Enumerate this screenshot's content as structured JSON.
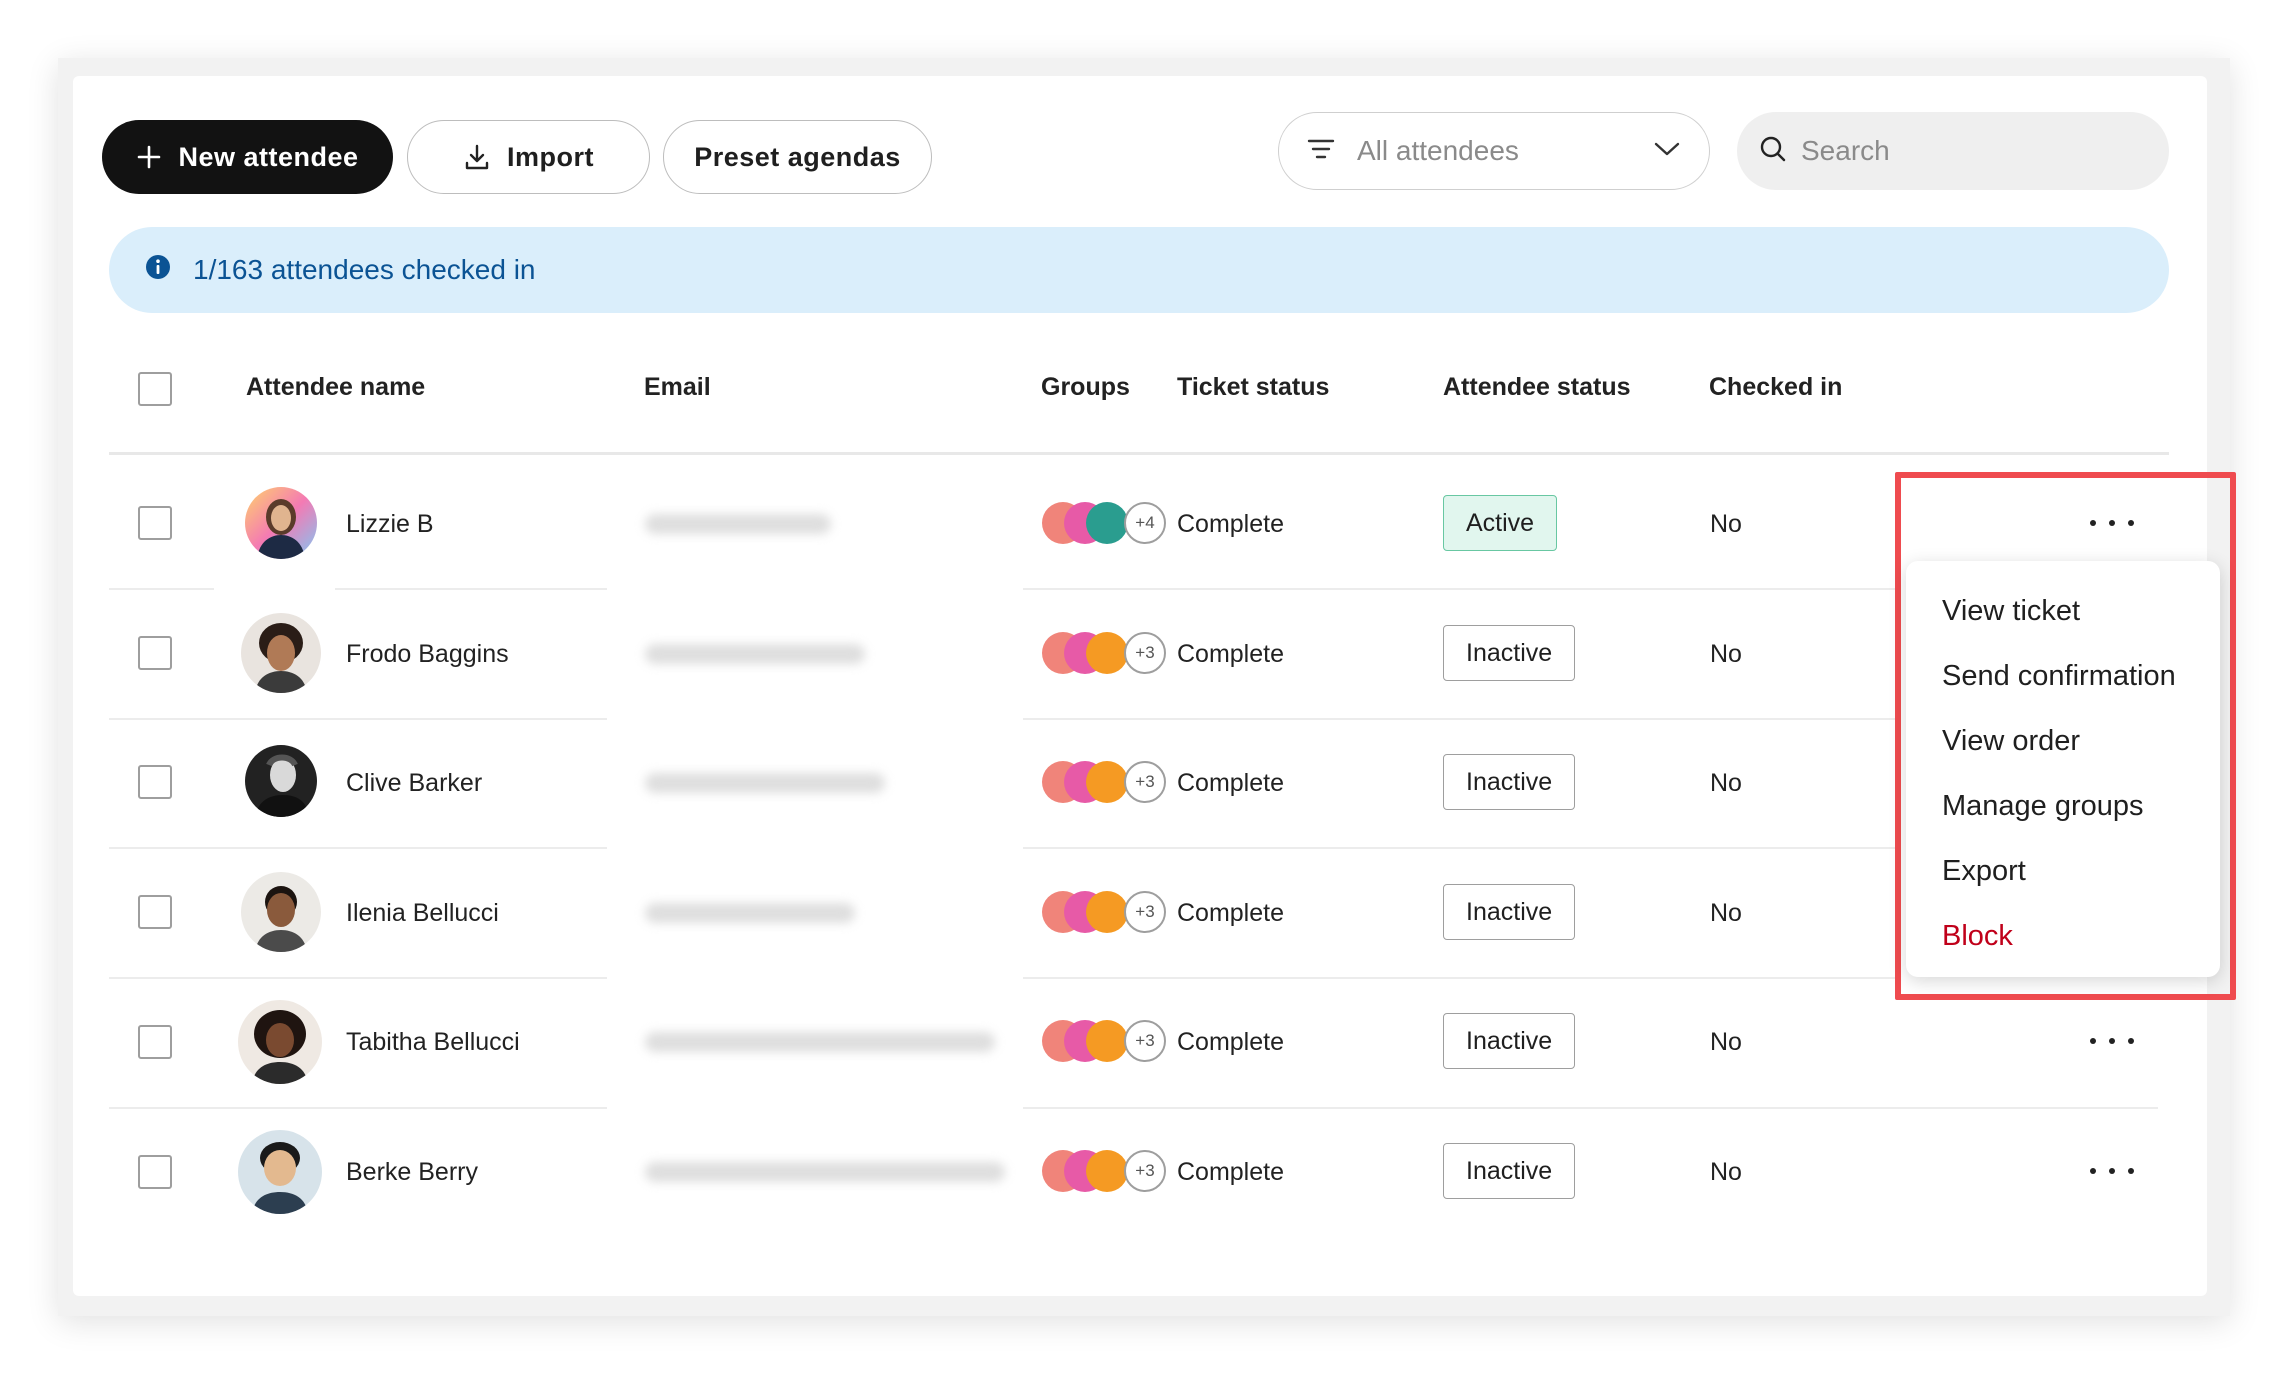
{
  "toolbar": {
    "new_attendee_label": "New attendee",
    "import_label": "Import",
    "preset_label": "Preset agendas",
    "filter_label": "All attendees",
    "search_placeholder": "Search"
  },
  "banner": {
    "text": "1/163 attendees checked in"
  },
  "table": {
    "headers": {
      "name": "Attendee name",
      "email": "Email",
      "groups": "Groups",
      "ticket": "Ticket status",
      "attendee_status": "Attendee status",
      "checked_in": "Checked in"
    },
    "rows": [
      {
        "name": "Lizzie B",
        "groups_more": "+4",
        "ticket_status": "Complete",
        "attendee_status": "Active",
        "checked_in": "No"
      },
      {
        "name": "Frodo Baggins",
        "groups_more": "+3",
        "ticket_status": "Complete",
        "attendee_status": "Inactive",
        "checked_in": "No"
      },
      {
        "name": "Clive Barker",
        "groups_more": "+3",
        "ticket_status": "Complete",
        "attendee_status": "Inactive",
        "checked_in": "No"
      },
      {
        "name": "Ilenia Bellucci",
        "groups_more": "+3",
        "ticket_status": "Complete",
        "attendee_status": "Inactive",
        "checked_in": "No"
      },
      {
        "name": "Tabitha Bellucci",
        "groups_more": "+3",
        "ticket_status": "Complete",
        "attendee_status": "Inactive",
        "checked_in": "No"
      },
      {
        "name": "Berke Berry",
        "groups_more": "+3",
        "ticket_status": "Complete",
        "attendee_status": "Inactive",
        "checked_in": "No"
      }
    ]
  },
  "menu": {
    "items": [
      {
        "label": "View ticket"
      },
      {
        "label": "Send confirmation"
      },
      {
        "label": "View order"
      },
      {
        "label": "Manage groups"
      },
      {
        "label": "Export"
      },
      {
        "label": "Block"
      }
    ]
  },
  "colors": {
    "primary_button": "#121212",
    "banner_bg": "#daeefb",
    "banner_text": "#0b5394",
    "active_badge_bg": "#e1f6ee",
    "active_badge_border": "#68c7a2",
    "danger": "#c0001a",
    "highlight": "#ef4b4f",
    "group_colors": [
      "#f0847a",
      "#e75aa7",
      "#2a9d8f",
      "#f59a23"
    ]
  },
  "icons": {
    "new": "plus-icon",
    "import": "download-icon",
    "filter": "filter-lines-icon",
    "dropdown": "chevron-down-icon",
    "search": "search-icon",
    "info": "info-icon",
    "row_actions": "more-horizontal-icon"
  }
}
